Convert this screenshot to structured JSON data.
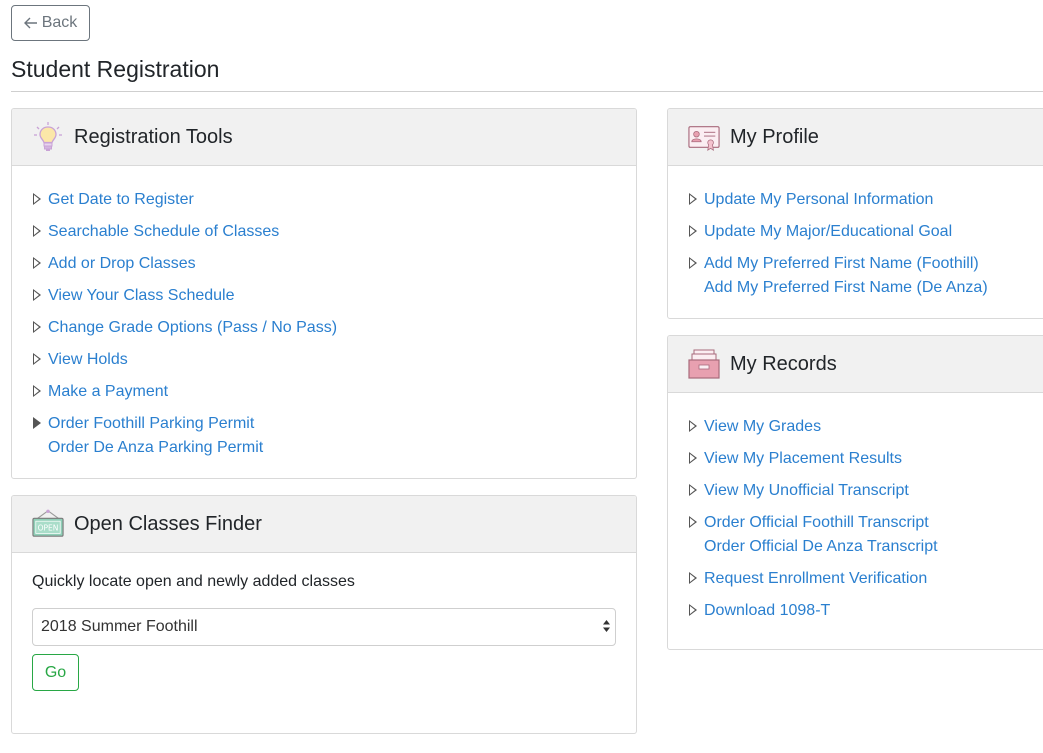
{
  "back": {
    "label": "Back"
  },
  "page": {
    "title": "Student Registration"
  },
  "registration_tools": {
    "title": "Registration Tools",
    "items": [
      {
        "links": [
          "Get Date to Register"
        ]
      },
      {
        "links": [
          "Searchable Schedule of Classes"
        ]
      },
      {
        "links": [
          "Add or Drop Classes"
        ]
      },
      {
        "links": [
          "View Your Class Schedule"
        ]
      },
      {
        "links": [
          "Change Grade Options (Pass / No Pass)"
        ]
      },
      {
        "links": [
          "View Holds"
        ]
      },
      {
        "links": [
          "Make a Payment"
        ]
      },
      {
        "links": [
          "Order Foothill Parking Permit",
          "Order De Anza Parking Permit"
        ]
      }
    ]
  },
  "open_classes": {
    "title": "Open Classes Finder",
    "description": "Quickly locate open and newly added classes",
    "selected_term": "2018 Summer Foothill",
    "go_label": "Go"
  },
  "my_profile": {
    "title": "My Profile",
    "items": [
      {
        "links": [
          "Update My Personal Information"
        ]
      },
      {
        "links": [
          "Update My Major/Educational Goal"
        ]
      },
      {
        "links": [
          "Add My Preferred First Name (Foothill)",
          "Add My Preferred First Name (De Anza)"
        ]
      }
    ]
  },
  "my_records": {
    "title": "My Records",
    "items": [
      {
        "links": [
          "View My Grades"
        ]
      },
      {
        "links": [
          "View My Placement Results"
        ]
      },
      {
        "links": [
          "View My Unofficial Transcript"
        ]
      },
      {
        "links": [
          "Order Official Foothill Transcript",
          "Order Official De Anza Transcript"
        ]
      },
      {
        "links": [
          "Request Enrollment Verification"
        ]
      },
      {
        "links": [
          "Download 1098-T"
        ]
      }
    ]
  },
  "colors": {
    "link": "#2a7fcf",
    "go_button": "#28a745",
    "header_bg": "#f1f1f1"
  },
  "icons": {
    "tools": "lightbulb-icon",
    "finder": "open-sign-icon",
    "profile": "id-card-icon",
    "records": "file-box-icon"
  }
}
